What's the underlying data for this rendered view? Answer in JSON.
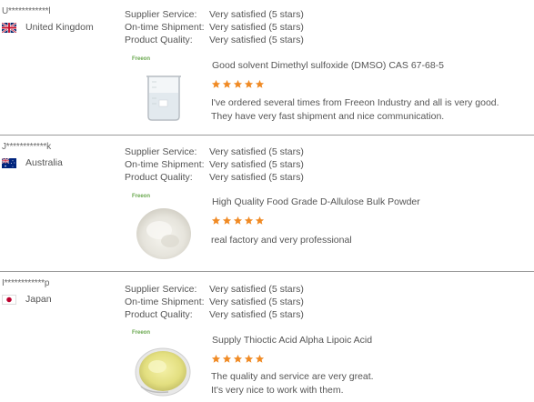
{
  "reviews": [
    {
      "name": "U************l",
      "country": "United Kingdom",
      "flag": "uk",
      "supplier_service_label": "Supplier Service:",
      "supplier_service_value": "Very satisfied (5 stars)",
      "on_time_label": "On-time Shipment:",
      "on_time_value": "Very satisfied (5 stars)",
      "quality_label": "Product Quality:",
      "quality_value": "Very satisfied (5 stars)",
      "brand": "Freeon",
      "product": "Good solvent Dimethyl sulfoxide (DMSO) CAS 67-68-5",
      "stars": 5,
      "comment_line1": "I've ordered several times from Freeon Industry and all is very good.",
      "comment_line2": "They have very fast shipment and nice communication."
    },
    {
      "name": "J************k",
      "country": "Australia",
      "flag": "au",
      "supplier_service_label": "Supplier Service:",
      "supplier_service_value": "Very satisfied (5 stars)",
      "on_time_label": "On-time Shipment:",
      "on_time_value": "Very satisfied (5 stars)",
      "quality_label": "Product Quality:",
      "quality_value": "Very satisfied (5 stars)",
      "brand": "Freeon",
      "product": "High Quality Food Grade D-Allulose Bulk Powder",
      "stars": 5,
      "comment_line1": "real factory and very professional",
      "comment_line2": ""
    },
    {
      "name": "I************p",
      "country": "Japan",
      "flag": "jp",
      "supplier_service_label": "Supplier Service:",
      "supplier_service_value": "Very satisfied (5 stars)",
      "on_time_label": "On-time Shipment:",
      "on_time_value": "Very satisfied (5 stars)",
      "quality_label": "Product Quality:",
      "quality_value": "Very satisfied (5 stars)",
      "brand": "Freeon",
      "product": "Supply Thioctic Acid Alpha Lipoic Acid",
      "stars": 5,
      "comment_line1": "The quality and service are very great.",
      "comment_line2": "It's very nice to work with them."
    }
  ],
  "colors": {
    "star": "#f08a24",
    "divider": "#9a9a9a",
    "text": "#555555",
    "brand": "#6aa84f"
  }
}
